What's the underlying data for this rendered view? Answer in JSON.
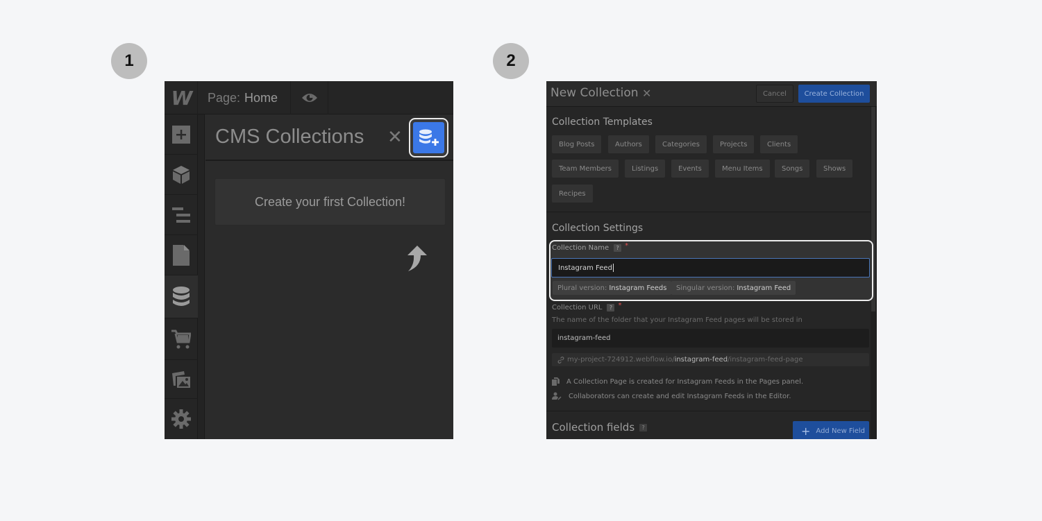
{
  "steps": [
    "1",
    "2"
  ],
  "panel1": {
    "logo": "W",
    "page_label": "Page:",
    "page_value": "Home",
    "title": "CMS Collections",
    "close_glyph": "✕",
    "empty_message": "Create your first Collection!",
    "sidebar": [
      {
        "icon": "add-panel-icon",
        "active": false
      },
      {
        "icon": "components-cube-icon",
        "active": false
      },
      {
        "icon": "navigator-icon",
        "active": false
      },
      {
        "icon": "pages-icon",
        "active": false
      },
      {
        "icon": "cms-database-icon",
        "active": true
      },
      {
        "icon": "ecommerce-cart-icon",
        "active": false
      },
      {
        "icon": "assets-images-icon",
        "active": false
      },
      {
        "icon": "settings-gear-icon",
        "active": false
      }
    ],
    "accent_color": "#3b78e7"
  },
  "panel2": {
    "title": "New Collection",
    "close_glyph": "✕",
    "cancel_label": "Cancel",
    "create_label": "Create Collection",
    "templates_title": "Collection Templates",
    "templates": [
      "Blog Posts",
      "Authors",
      "Categories",
      "Projects",
      "Clients",
      "Team Members",
      "Listings",
      "Events",
      "Menu Items",
      "Songs",
      "Shows",
      "Recipes"
    ],
    "settings_title": "Collection Settings",
    "name_label": "Collection Name",
    "help_glyph": "?",
    "required_glyph": "*",
    "name_value": "Instagram Feed",
    "plural_key": "Plural version:",
    "plural_value": "Instagram Feeds",
    "singular_key": "Singular version:",
    "singular_value": "Instagram Feed",
    "url_label": "Collection URL",
    "url_help": "The name of the folder that your Instagram Feed pages will be stored in",
    "url_value": "instagram-feed",
    "url_preview_prefix": "my-project-724912.webflow.io/",
    "url_preview_slug": "instagram-feed",
    "url_preview_suffix": "/instagram-feed-page",
    "info_pages": "A Collection Page is created for Instagram Feeds in the Pages panel.",
    "info_editor": "Collaborators can create and edit Instagram Feeds in the Editor.",
    "fields_title": "Collection fields",
    "add_field_label": "Add New Field",
    "accent_color": "#1e4e9c"
  }
}
